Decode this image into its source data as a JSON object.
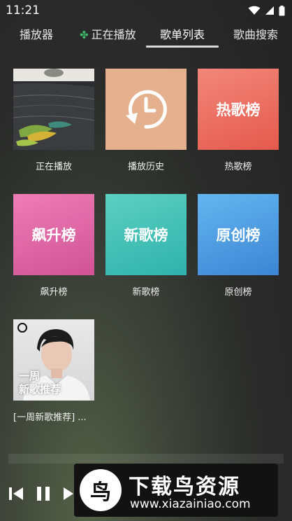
{
  "status_bar": {
    "time": "11:21"
  },
  "tabs": [
    {
      "label": "播放器"
    },
    {
      "label": "正在播放"
    },
    {
      "label": "歌单列表"
    },
    {
      "label": "歌曲搜索"
    }
  ],
  "grid": [
    {
      "caption": "正在播放",
      "cover_text": ""
    },
    {
      "caption": "播放历史",
      "cover_text": ""
    },
    {
      "caption": "热歌榜",
      "cover_text": "热歌榜"
    },
    {
      "caption": "飙升榜",
      "cover_text": "飙升榜"
    },
    {
      "caption": "新歌榜",
      "cover_text": "新歌榜"
    },
    {
      "caption": "原创榜",
      "cover_text": "原创榜"
    },
    {
      "caption": "[一周新歌推荐] ...",
      "cover_line1": "一周",
      "cover_line2": "新歌推荐"
    }
  ],
  "watermark": {
    "logo_glyph": "鸟",
    "title": "下载鸟资源",
    "url": "www.xiazainiao.com"
  },
  "colors": {
    "accent_clover": "#3fb86a",
    "tab_indicator": "#d8d8d8"
  }
}
